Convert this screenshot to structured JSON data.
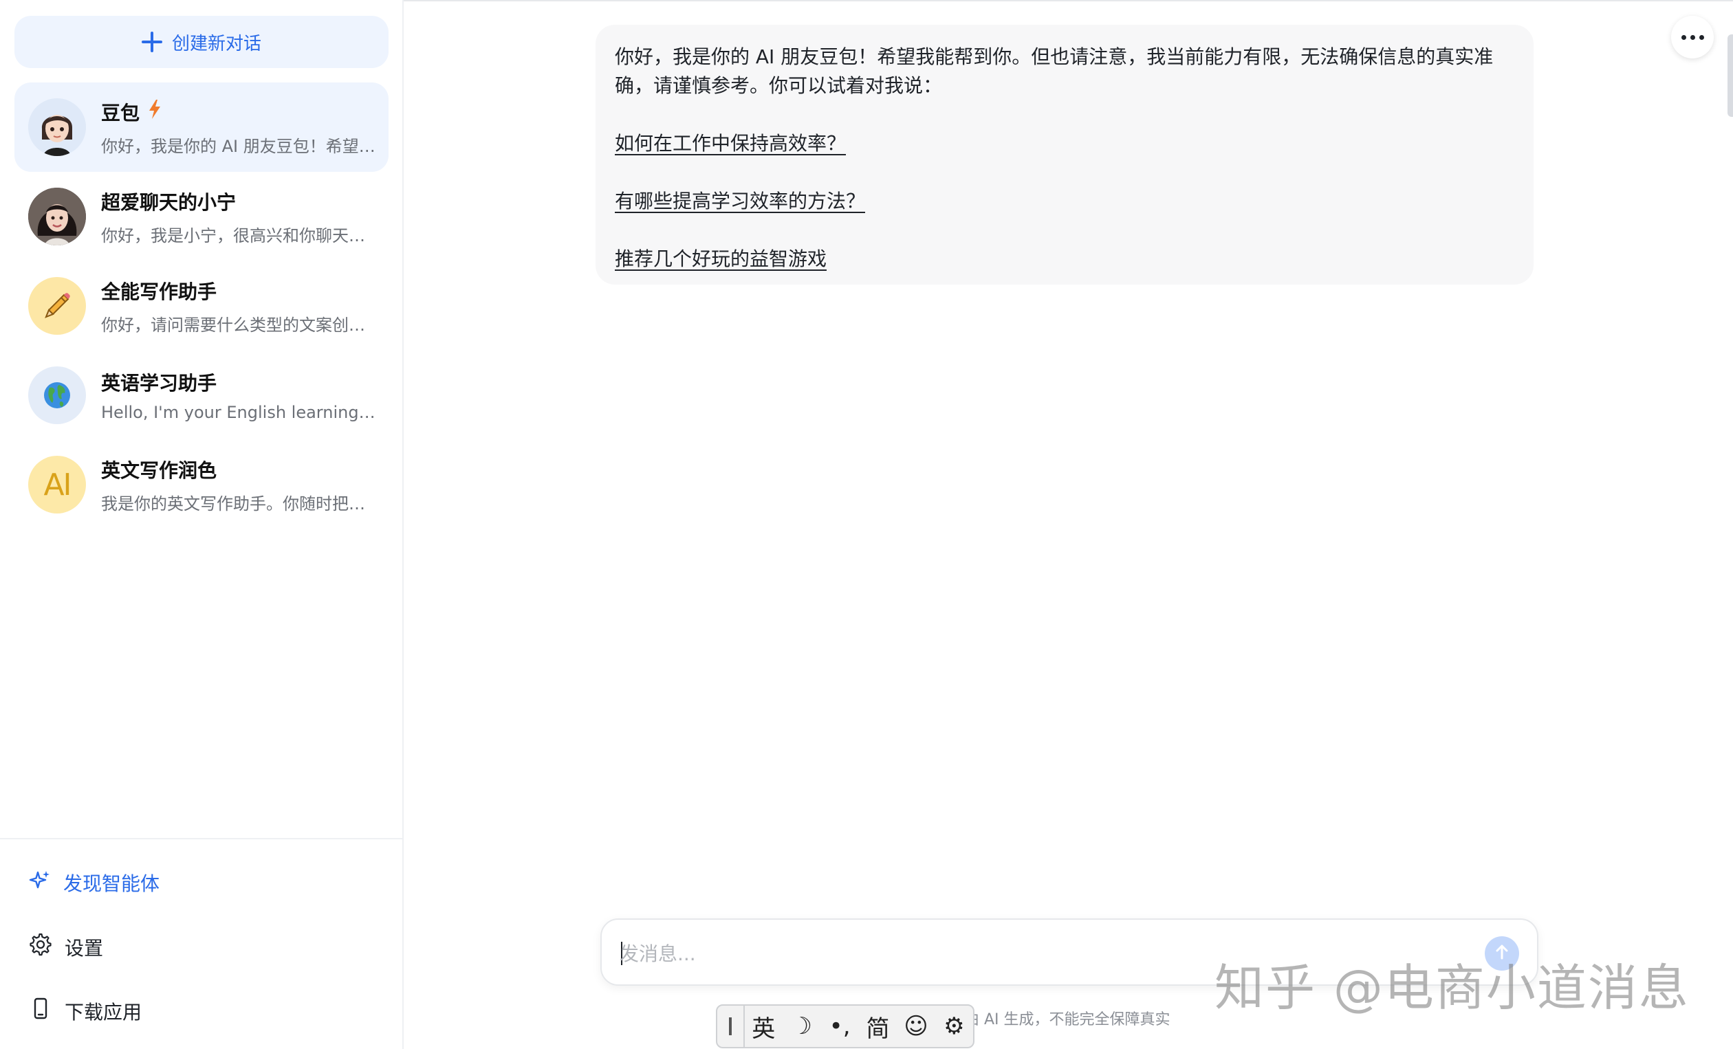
{
  "sidebar": {
    "new_chat_label": "创建新对话",
    "conversations": [
      {
        "title": "豆包",
        "preview": "你好，我是你的 AI 朋友豆包！希望…",
        "avatar": "doubao-avatar"
      },
      {
        "title": "超爱聊天的小宁",
        "preview": "你好，我是小宁，很高兴和你聊天…",
        "avatar": "xiaoning-avatar"
      },
      {
        "title": "全能写作助手",
        "preview": "你好，请问需要什么类型的文案创…",
        "avatar": "pencil-icon"
      },
      {
        "title": "英语学习助手",
        "preview": "Hello, I'm your English learning ass…",
        "avatar": "globe-icon"
      },
      {
        "title": "英文写作润色",
        "preview": "我是你的英文写作助手。你随时把…",
        "avatar": "ai-text-icon",
        "avatar_text": "AI"
      }
    ],
    "discover_label": "发现智能体",
    "settings_label": "设置",
    "download_label": "下载应用"
  },
  "message": {
    "intro": "你好，我是你的 AI 朋友豆包！希望我能帮到你。但也请注意，我当前能力有限，无法确保信息的真实准确，请谨慎参考。你可以试着对我说：",
    "suggestions": [
      "如何在工作中保持高效率？",
      "有哪些提高学习效率的方法？",
      "推荐几个好玩的益智游戏"
    ]
  },
  "composer": {
    "placeholder": "发消息...",
    "disclaimer": "容由 AI 生成，不能完全保障真实"
  },
  "ime": {
    "keys": [
      "英",
      "☽",
      "•,",
      "简",
      "☺",
      "⚙"
    ]
  },
  "watermark": "知乎 @电商小道消息",
  "colors": {
    "accent": "#2a6be8",
    "active_bg": "#eef4fe",
    "bubble_bg": "#f7f7f8",
    "lightning": "#f07b2c"
  }
}
